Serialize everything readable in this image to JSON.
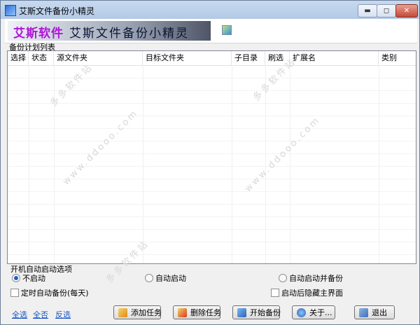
{
  "window": {
    "title": "艾斯文件备份小精灵",
    "controls": {
      "minimize": "▬",
      "maximize": "◻",
      "close": "✕"
    }
  },
  "banner": {
    "brand": "艾斯软件",
    "product": "艾斯文件备份小精灵"
  },
  "plan_list": {
    "label": "备份计划列表",
    "columns": [
      "选择",
      "状态",
      "源文件夹",
      "目标文件夹",
      "子目录",
      "刷选",
      "扩展名",
      "类别"
    ]
  },
  "watermark": {
    "lines": [
      "www.ddooo.com",
      "多多软件站"
    ]
  },
  "startup": {
    "title": "开机自动启动选项",
    "options": [
      {
        "label": "不启动",
        "selected": true
      },
      {
        "label": "自动启动",
        "selected": false
      },
      {
        "label": "自动启动并备份",
        "selected": false
      }
    ]
  },
  "checkboxes": {
    "timed_backup": {
      "label": "定时自动备份(每天)",
      "checked": false
    },
    "hide_main": {
      "label": "启动后隐藏主界面",
      "checked": false
    }
  },
  "links": {
    "select_all": "全选",
    "select_none": "全否",
    "invert": "反选"
  },
  "buttons": {
    "add": "添加任务",
    "delete": "删除任务",
    "start": "开始备份",
    "about": "关于...",
    "exit": "退出"
  },
  "icons": {
    "app": "folder-backup-icon",
    "add": "add-task-icon",
    "delete": "delete-task-icon",
    "start": "start-backup-icon",
    "about": "info-icon",
    "exit": "exit-icon"
  }
}
